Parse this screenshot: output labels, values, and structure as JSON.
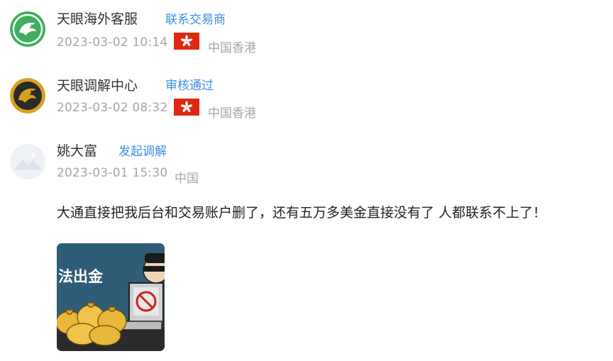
{
  "comments": [
    {
      "user": "天眼海外客服",
      "action": "联系交易商",
      "timestamp": "2023-03-02 10:14",
      "flag": "hong-kong-flag",
      "region": "中国香港",
      "avatar": "eagle-green-avatar",
      "avatar_color": "#3fae5f"
    },
    {
      "user": "天眼调解中心",
      "action": "审核通过",
      "timestamp": "2023-03-02 08:32",
      "flag": "hong-kong-flag",
      "region": "中国香港",
      "avatar": "eagle-gold-avatar",
      "avatar_color": "#d6a21e"
    },
    {
      "user": "姚大富",
      "action": "发起调解",
      "timestamp": "2023-03-01 15:30",
      "region": "中国",
      "avatar": "default-landscape-avatar",
      "text": "大通直接把我后台和交易账户删了，还有五万多美金直接没有了 人都联系不上了！",
      "attachment": {
        "caption": "法出金",
        "icon": "money-bags-thief-illustration"
      }
    }
  ],
  "colors": {
    "link": "#3a8ee6",
    "meta": "#a6a6a6",
    "text": "#222222",
    "flag_red": "#de2910"
  }
}
